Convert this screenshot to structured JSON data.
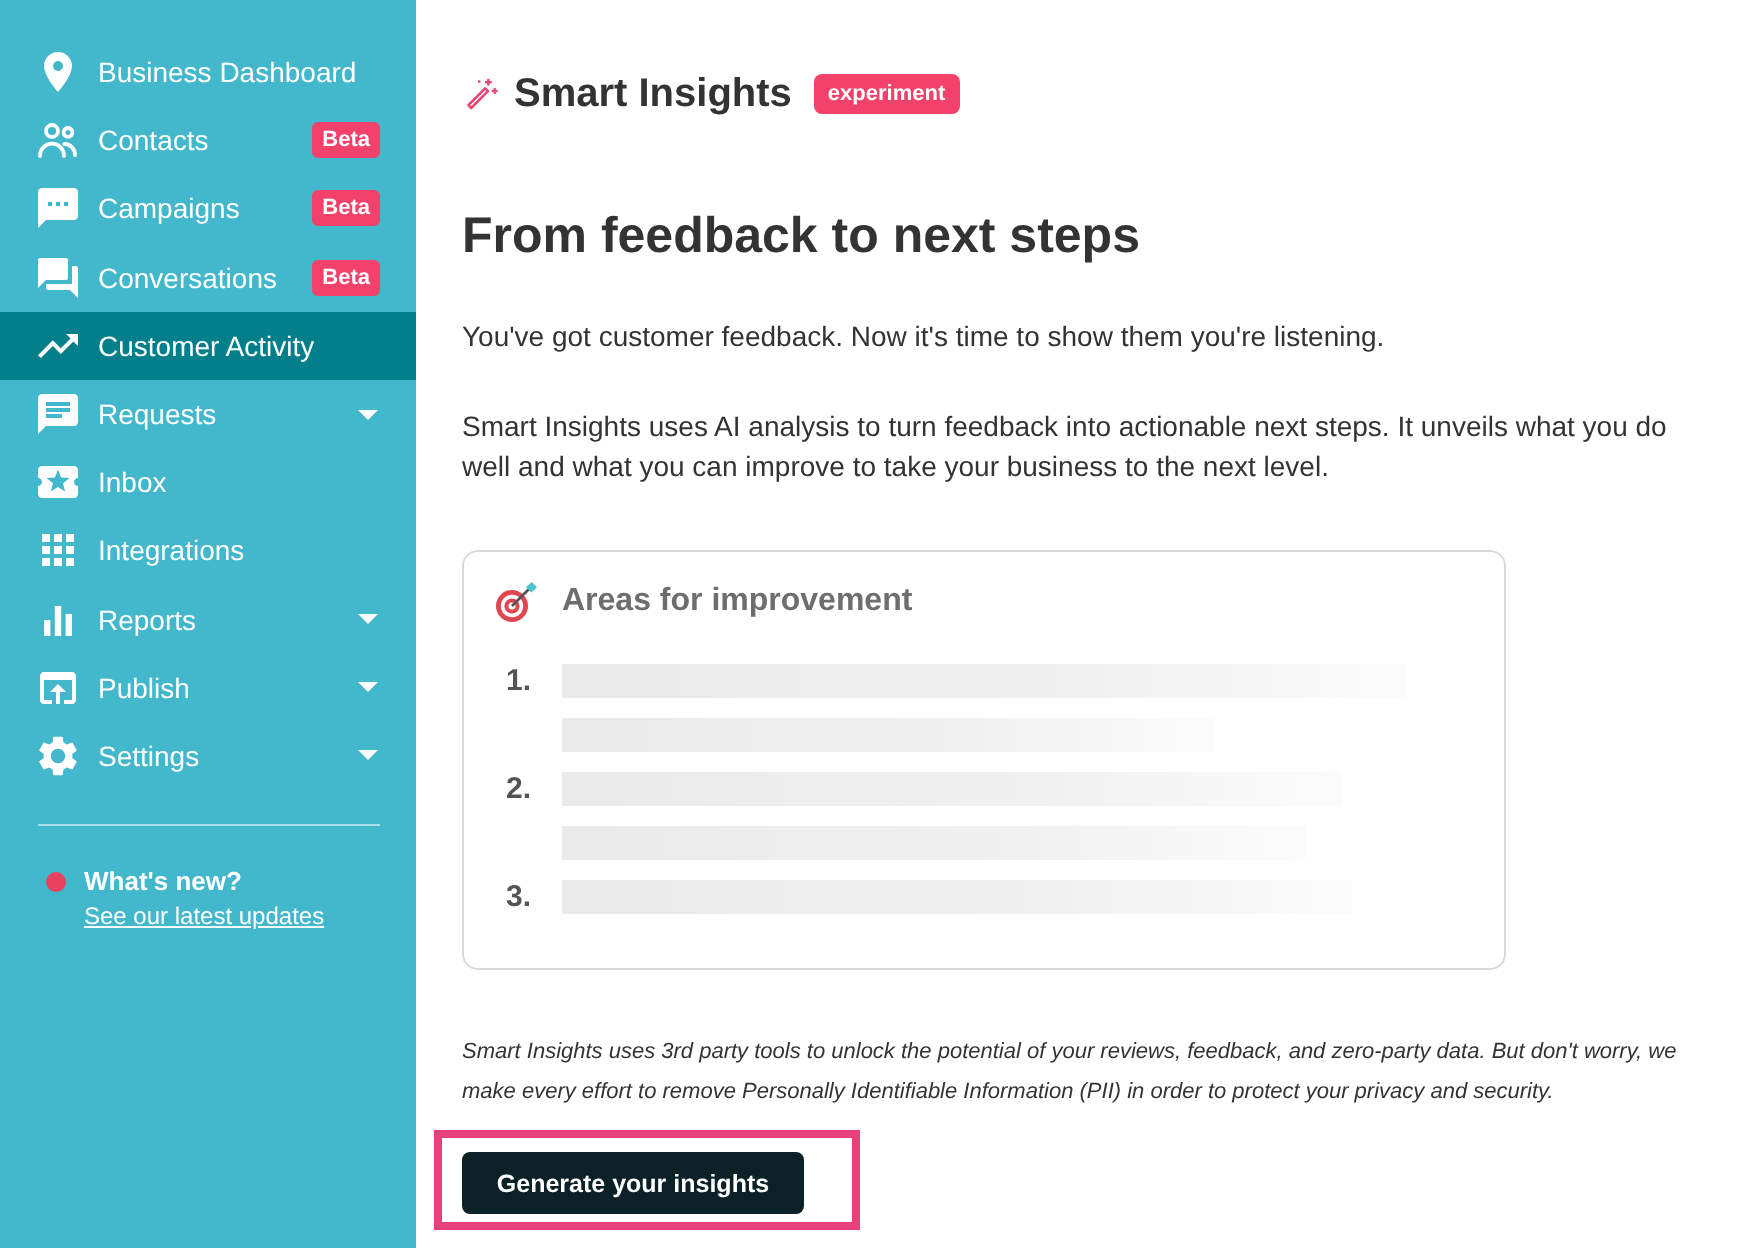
{
  "sidebar": {
    "items": [
      {
        "label": "Business Dashboard",
        "selected": false,
        "submenu": false
      },
      {
        "label": "Contacts",
        "badge": "Beta",
        "selected": false,
        "submenu": false
      },
      {
        "label": "Campaigns",
        "badge": "Beta",
        "selected": false,
        "submenu": false
      },
      {
        "label": "Conversations",
        "badge": "Beta",
        "selected": false,
        "submenu": false
      },
      {
        "label": "Customer Activity",
        "selected": true,
        "submenu": false
      },
      {
        "label": "Requests",
        "selected": false,
        "submenu": true
      },
      {
        "label": "Inbox",
        "selected": false,
        "submenu": false
      },
      {
        "label": "Integrations",
        "selected": false,
        "submenu": false
      },
      {
        "label": "Reports",
        "selected": false,
        "submenu": true
      },
      {
        "label": "Publish",
        "selected": false,
        "submenu": true
      },
      {
        "label": "Settings",
        "selected": false,
        "submenu": true
      }
    ],
    "whats_new": {
      "title": "What's new?",
      "link": "See our latest updates",
      "unread": true
    }
  },
  "main": {
    "header": {
      "title": "Smart Insights",
      "badge": "experiment"
    },
    "heading": "From feedback to next steps",
    "intro": "You've got customer feedback. Now it's time to show them you're listening.",
    "description": "Smart Insights uses AI analysis to turn feedback into actionable next steps. It unveils what you do well and what you can improve to take your business to the next level.",
    "card": {
      "title": "Areas for improvement",
      "items": [
        {
          "number": "1."
        },
        {
          "number": "2."
        },
        {
          "number": "3."
        }
      ]
    },
    "disclaimer": "Smart Insights uses 3rd party tools to unlock the potential of your reviews, feedback, and zero-party data. But don't worry, we make every effort to remove Personally Identifiable Information (PII) in order to protect your privacy and security.",
    "button": {
      "label": "Generate your insights",
      "highlighted": true
    }
  }
}
